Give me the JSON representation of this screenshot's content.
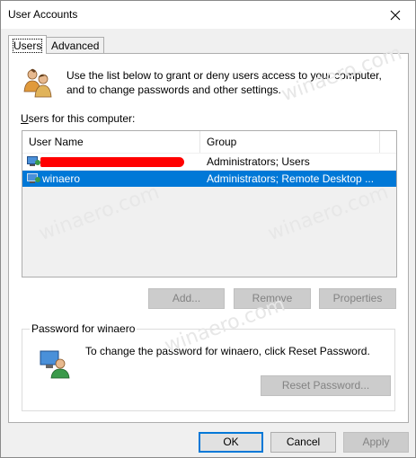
{
  "window": {
    "title": "User Accounts"
  },
  "tabs": [
    {
      "label": "Users",
      "active": true
    },
    {
      "label": "Advanced",
      "active": false
    }
  ],
  "intro": "Use the list below to grant or deny users access to your computer, and to change passwords and other settings.",
  "users_label_prefix": "U",
  "users_label_rest": "sers for this computer:",
  "list": {
    "columns": [
      "User Name",
      "Group"
    ],
    "rows": [
      {
        "user": "",
        "group": "Administrators; Users",
        "selected": false,
        "redacted": true
      },
      {
        "user": "winaero",
        "group": "Administrators; Remote Desktop ...",
        "selected": true,
        "redacted": false
      }
    ]
  },
  "list_buttons": {
    "add": "Add...",
    "remove": "Remove",
    "properties": "Properties"
  },
  "password_group": {
    "title": "Password for winaero",
    "text": "To change the password for winaero, click Reset Password.",
    "reset_button": "Reset Password..."
  },
  "dialog_buttons": {
    "ok": "OK",
    "cancel": "Cancel",
    "apply": "Apply"
  },
  "watermarks": [
    "winaero.com",
    "winaero.com",
    "winaero.com",
    "winaero.com",
    "winaero.com",
    "winaero.com",
    "winaero.com"
  ],
  "colors": {
    "selection": "#0078d7",
    "redaction": "#ff0000"
  }
}
